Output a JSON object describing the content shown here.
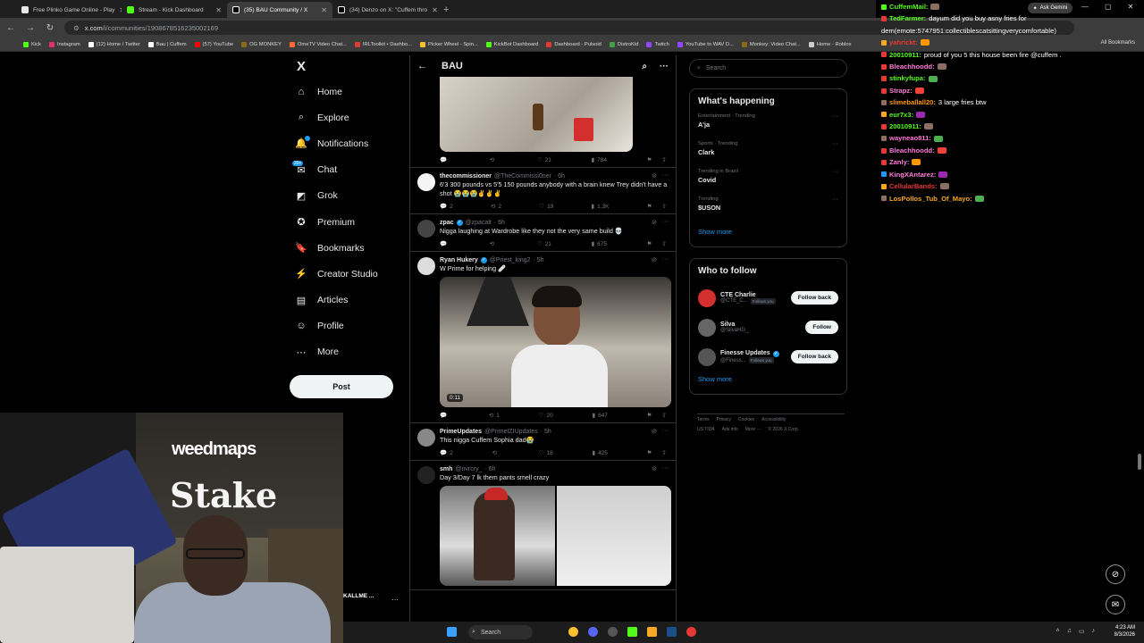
{
  "browser": {
    "tabs": [
      {
        "title": "Free Plinko Game Online - Play",
        "color": "#e8e8e8"
      },
      {
        "title": "Stream - Kick Dashboard",
        "color": "#53fc18"
      },
      {
        "title": "(35) BAU Community / X",
        "color": "#ffffff"
      },
      {
        "title": "(34) Denzo on X: \"Cuffem thro",
        "color": "#ffffff"
      }
    ],
    "new_tab": "+",
    "url_host": "x.com",
    "url_path": "/i/communities/1908678516235002169",
    "bookmarks": [
      {
        "label": "Kick",
        "color": "#53fc18"
      },
      {
        "label": "Instagram",
        "color": "#e1306c"
      },
      {
        "label": "(12) Home / Twitter",
        "color": "#ffffff"
      },
      {
        "label": "Bau | Cuffem",
        "color": "#ffffff"
      },
      {
        "label": "(57) YouTube",
        "color": "#ff0000"
      },
      {
        "label": "OG MONKEY",
        "color": "#8b6914"
      },
      {
        "label": "OmeTV Video Chat...",
        "color": "#ff6b35"
      },
      {
        "label": "IRLToolkit • Dashbo...",
        "color": "#e53935"
      },
      {
        "label": "Picker Wheel - Spin...",
        "color": "#fbc02d"
      },
      {
        "label": "KickBot Dashboard",
        "color": "#53fc18"
      },
      {
        "label": "Dashboard - Pulsoid",
        "color": "#e53935"
      },
      {
        "label": "DistroKid",
        "color": "#43a047"
      },
      {
        "label": "Twitch",
        "color": "#9146ff"
      },
      {
        "label": "YouTube to WAV D...",
        "color": "#9146ff"
      },
      {
        "label": "Monkey: Video Chat...",
        "color": "#8b6914"
      },
      {
        "label": "Home - Roblox",
        "color": "#cccccc"
      }
    ],
    "all_bookmarks": "All Bookmarks",
    "ask_gemini": "Ask Gemini"
  },
  "leftnav": {
    "logo": "X",
    "items": [
      {
        "label": "Home",
        "icon": "home-icon",
        "glyph": "⌂"
      },
      {
        "label": "Explore",
        "icon": "search-icon",
        "glyph": "⌕"
      },
      {
        "label": "Notifications",
        "icon": "bell-icon",
        "glyph": "🔔"
      },
      {
        "label": "Chat",
        "icon": "chat-icon",
        "glyph": "✉"
      },
      {
        "label": "Grok",
        "icon": "grok-icon",
        "glyph": "◩"
      },
      {
        "label": "Premium",
        "icon": "premium-icon",
        "glyph": "✪"
      },
      {
        "label": "Bookmarks",
        "icon": "bookmark-icon",
        "glyph": "🔖"
      },
      {
        "label": "Creator Studio",
        "icon": "creator-icon",
        "glyph": "⚡"
      },
      {
        "label": "Articles",
        "icon": "articles-icon",
        "glyph": "▤"
      },
      {
        "label": "Profile",
        "icon": "profile-icon",
        "glyph": "☺"
      },
      {
        "label": "More",
        "icon": "more-icon",
        "glyph": "⋯"
      }
    ],
    "chat_badge": "20+",
    "post": "Post"
  },
  "feed": {
    "title": "BAU",
    "tweets": [
      {
        "name": "",
        "handle": "",
        "time": "",
        "text": "",
        "replies": "",
        "reposts": "",
        "likes": "21",
        "views": "784",
        "media": "top"
      },
      {
        "name": "thecommissioner",
        "handle": "@TheCommissi0ner",
        "time": "· 6h",
        "verified": false,
        "text": "6'3 300 pounds vs 5'5 150 pounds anybody with a brain knew Trey didn't have a shot 😭😭😭✌️✌️✌️",
        "replies": "2",
        "reposts": "2",
        "likes": "19",
        "views": "1.3K",
        "media": ""
      },
      {
        "name": "zpac",
        "handle": "@zpacalt",
        "time": "· 6h",
        "verified": true,
        "text": "Nigga laughing at Wardrobe like they not the very same build 💀",
        "replies": "",
        "reposts": "",
        "likes": "21",
        "views": "675",
        "media": ""
      },
      {
        "name": "Ryan Hukery",
        "handle": "@Priest_king2",
        "time": "· 5h",
        "verified": true,
        "text": "W Prime for helping 🩹",
        "replies": "",
        "reposts": "1",
        "likes": "20",
        "views": "647",
        "media": "video",
        "duration": "0:11"
      },
      {
        "name": "PrimeUpdates",
        "handle": "@PrimeIZIUpdates",
        "time": "· 5h",
        "verified": false,
        "text": "This nigga Cuffem Sophia dad😭",
        "replies": "2",
        "reposts": "",
        "likes": "18",
        "views": "425",
        "media": ""
      },
      {
        "name": "smh",
        "handle": "@nvrcry_",
        "time": "· 6h",
        "verified": false,
        "text": "Day 3/Day 7 lk them pants smell crazy",
        "replies": "",
        "reposts": "",
        "likes": "",
        "views": "",
        "media": "double"
      }
    ]
  },
  "right": {
    "search_placeholder": "Search",
    "happening_title": "What's happening",
    "trends": [
      {
        "category": "Entertainment · Trending",
        "name": "A'ja"
      },
      {
        "category": "Sports · Trending",
        "name": "Clark"
      },
      {
        "category": "Trending in Brazil",
        "name": "Covid"
      },
      {
        "category": "Trending",
        "name": "$USON"
      }
    ],
    "show_more": "Show more",
    "follow_title": "Who to follow",
    "follows": [
      {
        "name": "CTE Charlie",
        "handle": "@CTE_C...",
        "follows_you": "Follows you",
        "button": "Follow back",
        "color": "#d32f2f"
      },
      {
        "name": "Silva",
        "handle": "@SilvaHG_",
        "follows_you": "",
        "button": "Follow",
        "color": "#666666"
      },
      {
        "name": "Finesse Updates",
        "handle": "@Finess...",
        "follows_you": "Follows you",
        "button": "Follow back",
        "color": "#555555",
        "verified": true
      }
    ],
    "footer_line1": [
      "Terms",
      "Privacy",
      "Cookies",
      "Accessibility"
    ],
    "footer_line2": [
      "US TIDA",
      "Ads info",
      "More ···",
      "© 2026 X Corp."
    ]
  },
  "chat": [
    {
      "user": "CuffemMail:",
      "msg": "",
      "color": "#53fc18",
      "badge": "#53fc18"
    },
    {
      "user": "TedFarmer:",
      "msg": "dayum did you buy asny fries for",
      "color": "#53fc18",
      "badge": "#e53935"
    },
    {
      "user": "",
      "msg": "dem(emote:5747951:collectiblescatsittingverycomfortable)",
      "color": "#ffffff",
      "badge": ""
    },
    {
      "user": "yahrickt:",
      "msg": "",
      "color": "#e53935",
      "badge": "#f9a825"
    },
    {
      "user": "20010911:",
      "msg": "proud of you 5 this house been fire @cuffem .",
      "color": "#53fc18",
      "badge": "#e53935"
    },
    {
      "user": "Bleachhoodd:",
      "msg": "",
      "color": "#ff7ad9",
      "badge": "#e53935"
    },
    {
      "user": "stinkyfupa:",
      "msg": "",
      "color": "#53fc18",
      "badge": "#e53935"
    },
    {
      "user": "Strapz:",
      "msg": "",
      "color": "#ff7ad9",
      "badge": "#e53935"
    },
    {
      "user": "slimeballall20:",
      "msg": "3 large fries btw",
      "color": "#ff9800",
      "badge": "#8d6e63"
    },
    {
      "user": "eur7x3:",
      "msg": "",
      "color": "#53fc18",
      "badge": "#f9a825"
    },
    {
      "user": "20010911:",
      "msg": "",
      "color": "#53fc18",
      "badge": "#e53935"
    },
    {
      "user": "wayneao811:",
      "msg": "",
      "color": "#ff7ad9",
      "badge": "#8d6e63"
    },
    {
      "user": "Bleachhoodd:",
      "msg": "",
      "color": "#ff7ad9",
      "badge": "#e53935"
    },
    {
      "user": "Zanly:",
      "msg": "",
      "color": "#ff7ad9",
      "badge": "#e53935"
    },
    {
      "user": "KingXAntarez:",
      "msg": "",
      "color": "#ff7ad9",
      "badge": "#2196f3"
    },
    {
      "user": "CellularBands:",
      "msg": "",
      "color": "#e53935",
      "badge": "#f9a825"
    },
    {
      "user": "LosPollos_Tub_Of_Mayo:",
      "msg": "",
      "color": "#f9a825",
      "badge": "#8d6e63"
    }
  ],
  "stream": {
    "wall_text_1": "weedmaps",
    "wall_text_2": "Stake",
    "overlay_name": "KALLME ..."
  },
  "taskbar": {
    "search": "Search",
    "time": "4:23 AM",
    "date": "8/3/2026"
  }
}
